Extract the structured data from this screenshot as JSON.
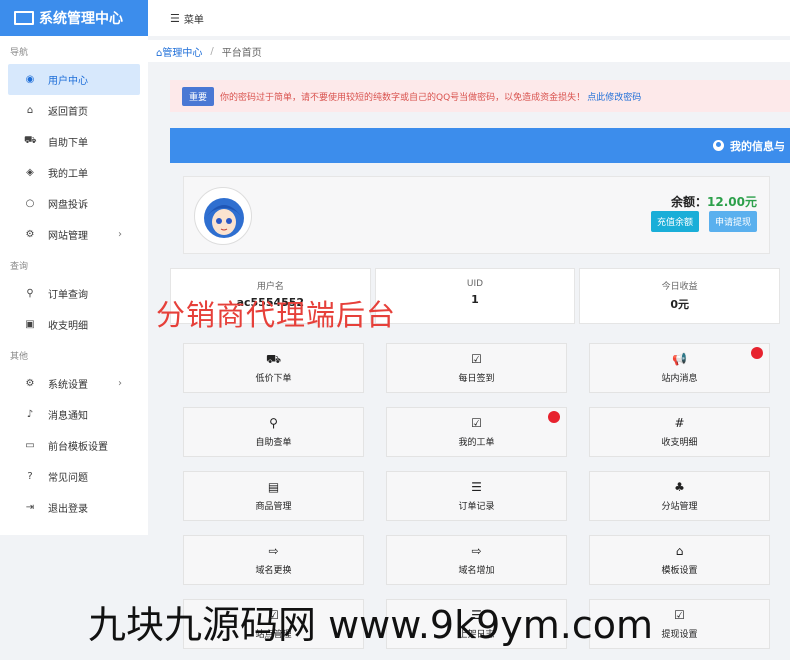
{
  "brand": {
    "title": "系统管理中心"
  },
  "topbar": {
    "menu_label": "菜单"
  },
  "sidebar": {
    "groups": [
      {
        "title": "导航",
        "items": [
          {
            "label": "用户中心",
            "icon": "user-circle-icon",
            "active": true
          },
          {
            "label": "返回首页",
            "icon": "home-icon"
          },
          {
            "label": "自助下单",
            "icon": "cart-icon"
          },
          {
            "label": "我的工单",
            "icon": "tag-icon"
          },
          {
            "label": "网盘投诉",
            "icon": "comment-icon"
          },
          {
            "label": "网站管理",
            "icon": "cogs-icon",
            "has_children": true
          }
        ]
      },
      {
        "title": "查询",
        "items": [
          {
            "label": "订单查询",
            "icon": "search-icon"
          },
          {
            "label": "收支明细",
            "icon": "money-icon"
          }
        ]
      },
      {
        "title": "其他",
        "items": [
          {
            "label": "系统设置",
            "icon": "gear-icon",
            "has_children": true
          },
          {
            "label": "消息通知",
            "icon": "bell-icon"
          },
          {
            "label": "前台模板设置",
            "icon": "desktop-icon"
          },
          {
            "label": "常见问题",
            "icon": "question-icon"
          },
          {
            "label": "退出登录",
            "icon": "logout-icon"
          }
        ]
      }
    ]
  },
  "breadcrumb": {
    "home": "管理中心",
    "current": "平台首页"
  },
  "notice": {
    "badge": "重要",
    "text": "你的密码过于简单，请不要使用较短的纯数字或自己的QQ号当做密码，以免造成资金损失！",
    "link": "点此修改密码"
  },
  "panel": {
    "title": "我的信息与"
  },
  "profile": {
    "balance_label": "余额：",
    "balance_value": "12.00元",
    "recharge_button": "充值余额",
    "withdraw_button": "申请提现"
  },
  "stats": [
    {
      "label": "用户名",
      "value": "ac5554552"
    },
    {
      "label": "UID",
      "value": "1"
    },
    {
      "label": "今日收益",
      "value": "0元"
    }
  ],
  "overlay_text": "分销商代理端后台",
  "tiles": [
    {
      "label": "低价下单",
      "icon": "cart-icon",
      "dot": false
    },
    {
      "label": "每日签到",
      "icon": "check-square-icon",
      "dot": false
    },
    {
      "label": "站内消息",
      "icon": "bullhorn-icon",
      "dot": true
    },
    {
      "label": "自助查单",
      "icon": "search-icon",
      "dot": false
    },
    {
      "label": "我的工单",
      "icon": "check-square-icon",
      "dot": true
    },
    {
      "label": "收支明细",
      "icon": "hashtag-icon",
      "dot": false
    },
    {
      "label": "商品管理",
      "icon": "list-alt-icon",
      "dot": false
    },
    {
      "label": "订单记录",
      "icon": "list-icon",
      "dot": false
    },
    {
      "label": "分站管理",
      "icon": "sitemap-icon",
      "dot": false
    },
    {
      "label": "域名更换",
      "icon": "sign-out-icon",
      "dot": false
    },
    {
      "label": "域名增加",
      "icon": "sign-out-icon",
      "dot": false
    },
    {
      "label": "模板设置",
      "icon": "home-icon",
      "dot": false
    },
    {
      "label": "站点管理",
      "icon": "check-square-icon",
      "dot": false
    },
    {
      "label": "上架日志",
      "icon": "list-icon",
      "dot": false
    },
    {
      "label": "提现设置",
      "icon": "check-square-icon",
      "dot": false
    }
  ],
  "watermark": "九块九源码网 www.9k9ym.com"
}
